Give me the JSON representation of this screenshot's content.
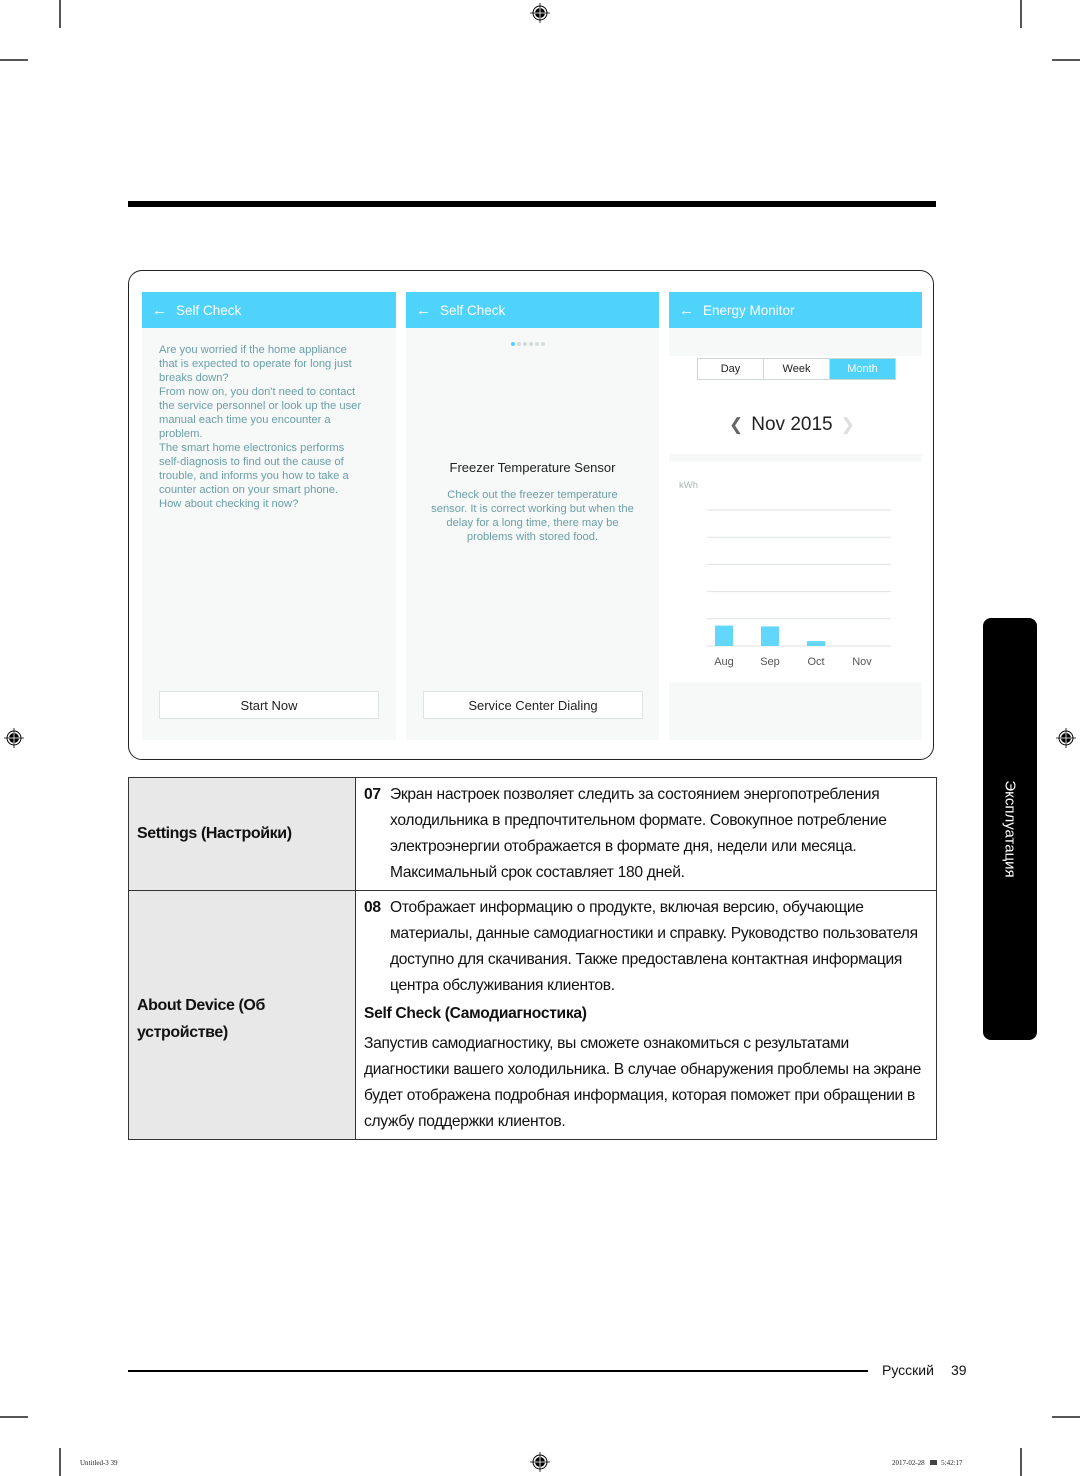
{
  "screens": [
    {
      "title": "Self Check",
      "body_lines": [
        "Are you worried if the home appliance",
        "that is expected to operate for long just",
        "breaks down?",
        "From now on, you don't need to contact",
        "the service personnel or look up the user",
        "manual each time you encounter a",
        "problem.",
        "The smart home electronics performs",
        "self-diagnosis to find out the cause of",
        "trouble, and informs you how to take a",
        "counter action on your smart phone.",
        "How about checking it now?"
      ],
      "button": "Start Now"
    },
    {
      "title": "Self Check",
      "pager": {
        "count": 6,
        "active_index": 0
      },
      "heading": "Freezer Temperature Sensor",
      "body_lines": [
        "Check out the freezer temperature",
        "sensor. It is correct working but when the",
        "delay for a long time, there may be",
        "problems with stored food."
      ],
      "button": "Service Center Dialing"
    },
    {
      "title": "Energy Monitor",
      "tabs": [
        {
          "label": "Day",
          "active": false
        },
        {
          "label": "Week",
          "active": false
        },
        {
          "label": "Month",
          "active": true
        }
      ],
      "period": "Nov 2015"
    }
  ],
  "chart_data": {
    "type": "bar",
    "title": "",
    "ylabel": "kWh",
    "xlabel": "",
    "categories": [
      "Aug",
      "Sep",
      "Oct",
      "Nov"
    ],
    "values": [
      0.75,
      0.72,
      0.18,
      0
    ],
    "ylim": [
      0,
      5
    ],
    "grid": true,
    "gridlines": 5,
    "bar_color": "#62d6fb"
  },
  "table": {
    "rows": [
      {
        "label": "Settings (Настройки)",
        "items": [
          {
            "number": "07",
            "lines": [
              "Экран настроек позволяет следить за состоянием энергопотребления",
              "холодильника в предпочтительном формате. Совокупное потребление",
              "электроэнергии отображается в формате дня, недели или месяца.",
              "Максимальный срок составляет 180 дней."
            ]
          }
        ]
      },
      {
        "label_lines": [
          "About Device (Об",
          "устройстве)"
        ],
        "items": [
          {
            "number": "08",
            "lines": [
              "Отображает информацию о продукте, включая версию, обучающие",
              "материалы, данные самодиагностики и справку. Руководство пользователя",
              "доступно для скачивания. Также предоставлена контактная информация",
              "центра обслуживания клиентов."
            ]
          }
        ],
        "subheading": "Self Check (Самодиагностика)",
        "sub_lines": [
          "Запустив самодиагностику, вы сможете ознакомиться с результатами",
          "диагностики вашего холодильника. В случае обнаружения проблемы на экране",
          "будет отображена подробная информация, которая поможет при обращении в",
          "службу поддержки клиентов."
        ]
      }
    ]
  },
  "side_tab": "Эксплуатация",
  "footer": {
    "language": "Русский",
    "page": "39"
  },
  "slug": {
    "file": "Untitled-3   39",
    "date": "2017-02-28",
    "time": "5:42:17"
  },
  "colors": {
    "accent": "#4fd3fb",
    "body_text": "#6aa0a7"
  }
}
